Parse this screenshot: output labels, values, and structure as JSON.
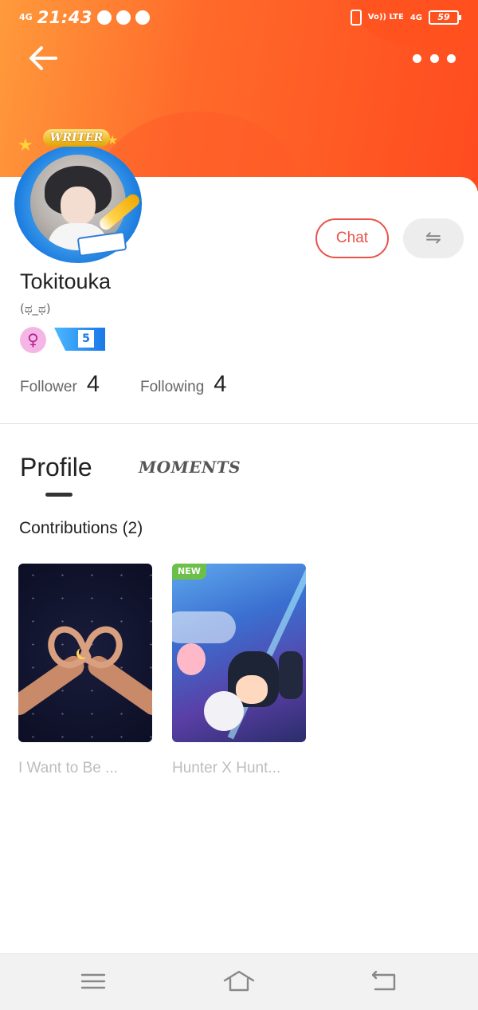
{
  "status_bar": {
    "network": "4G",
    "time": "21:43",
    "volte": "Vo)) LTE",
    "network_right": "4G",
    "battery": "59"
  },
  "profile": {
    "frame_badge": "WRITER",
    "name": "Tokitouka",
    "tagline": "(ಥ_ಥ)",
    "gender_icon": "female-icon",
    "level": "5",
    "chat_label": "Chat",
    "switch_icon": "swap-arrows-icon",
    "follower_label": "Follower",
    "follower_count": "4",
    "following_label": "Following",
    "following_count": "4"
  },
  "tabs": {
    "profile": "Profile",
    "moments": "MOMENTS"
  },
  "contributions": {
    "title": "Contributions (2)",
    "items": [
      {
        "title": "I Want to Be ...",
        "badge": ""
      },
      {
        "title": "Hunter X Hunt...",
        "badge": "NEW"
      }
    ]
  },
  "colors": {
    "header_start": "#ff9a3c",
    "header_end": "#ff4b1f",
    "chat_accent": "#e8524a",
    "new_badge": "#6cc04a"
  }
}
